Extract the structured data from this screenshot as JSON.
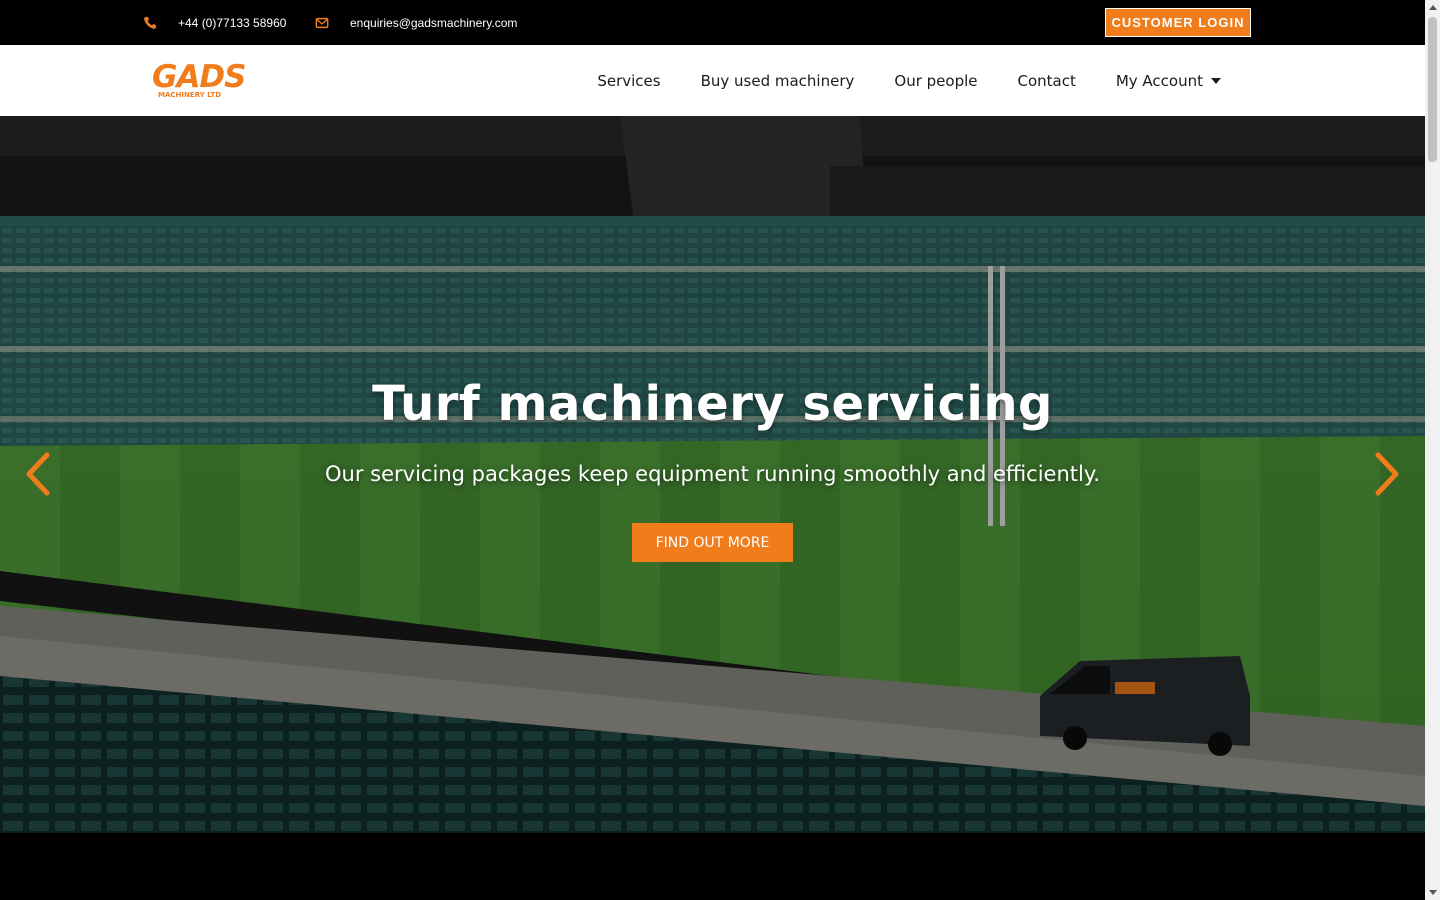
{
  "topbar": {
    "phone": "+44 (0)77133 58960",
    "email": "enquiries@gadsmachinery.com",
    "login_label": "CUSTOMER LOGIN"
  },
  "header": {
    "logo_text": "GADS",
    "logo_subtext": "MACHINERY LTD",
    "nav": {
      "services": "Services",
      "buy": "Buy used machinery",
      "people": "Our people",
      "contact": "Contact",
      "account": "My Account"
    }
  },
  "hero": {
    "title": "Turf machinery servicing",
    "subtitle": "Our servicing packages keep equipment running smoothly and efficiently.",
    "cta_label": "FIND OUT MORE"
  },
  "colors": {
    "accent": "#f07c1c",
    "topbar_bg": "#000000",
    "header_bg": "#ffffff"
  },
  "icons": {
    "phone": "phone-icon",
    "email": "envelope-icon",
    "prev": "chevron-left-icon",
    "next": "chevron-right-icon",
    "caret": "caret-down-icon"
  }
}
